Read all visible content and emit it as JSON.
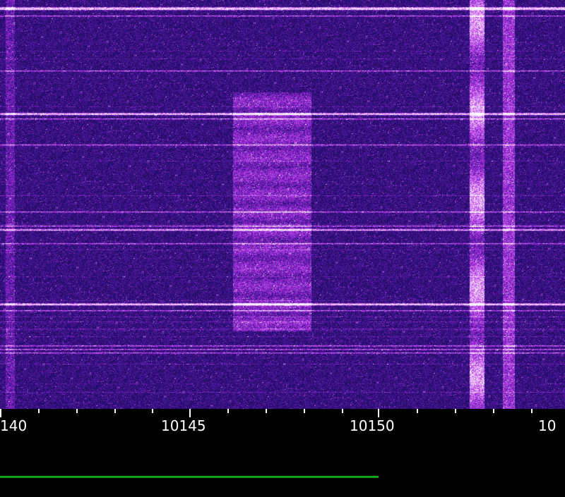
{
  "app": {
    "view": "waterfall spectrum display"
  },
  "colors": {
    "background": "#000000",
    "waterfall_base": "#2a0f7a",
    "waterfall_noise": "#5a20c8",
    "signal_peak": "#ffe8ff",
    "scale_text": "#ffffff",
    "tuning_bar": "#10a010"
  },
  "frequency_scale": {
    "labels": [
      {
        "text": "140"
      },
      {
        "text": "10145"
      },
      {
        "text": "10150"
      },
      {
        "text": "10"
      }
    ]
  },
  "tuning_bar": {
    "fraction_of_width": 0.67
  }
}
